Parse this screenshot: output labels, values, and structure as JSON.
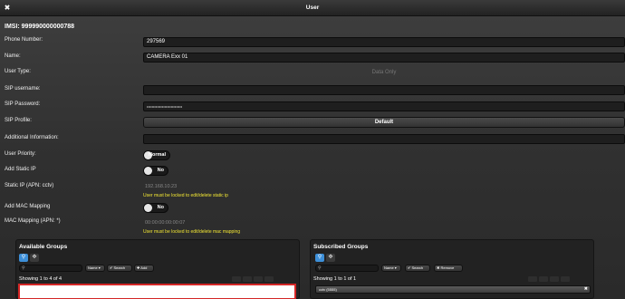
{
  "window": {
    "title": "User",
    "close_icon": "close-icon"
  },
  "imsi": "IMSI: 999990000000788",
  "fields": {
    "phone": {
      "label": "Phone Number:",
      "value": "297569"
    },
    "name": {
      "label": "Name:",
      "value": "CAMERA Exx 01"
    },
    "user_type": {
      "label": "User Type:",
      "value": "Data Only"
    },
    "sip_username": {
      "label": "SIP username:",
      "value": ""
    },
    "sip_password": {
      "label": "SIP Password:",
      "value": "••••••••••••••••••••••••••••"
    },
    "sip_profile": {
      "label": "SIP Profile:",
      "value": "Default"
    },
    "additional_info": {
      "label": "Additional Information:",
      "value": ""
    },
    "user_priority": {
      "label": "User Priority:",
      "value": "Normal"
    },
    "add_static_ip": {
      "label": "Add Static IP",
      "value": "No"
    },
    "static_ip": {
      "label": "Static IP (APN: cctv)",
      "value": "192.168.10.23",
      "warning": "User must be locked to edit/delete static ip"
    },
    "add_mac": {
      "label": "Add MAC Mapping",
      "value": "No"
    },
    "mac_mapping": {
      "label": "MAC Mapping (APN: *)",
      "value": "00:00:00:00:00:07",
      "warning": "User must be locked to edit/delete mac mapping"
    }
  },
  "available_groups": {
    "title": "Available Groups",
    "search_placeholder": "",
    "sort_select": "Name",
    "search_button": "Search",
    "add_button": "Add",
    "showing": "Showing 1 to 4 of 4"
  },
  "subscribed_groups": {
    "title": "Subscribed Groups",
    "search_placeholder": "",
    "sort_select": "Name",
    "search_button": "Search",
    "remove_button": "Remove",
    "showing": "Showing 1 to 1 of 1",
    "items": [
      "cctv (5555)"
    ]
  },
  "colors": {
    "accent": "#3d8fd8",
    "warning": "#f2e633",
    "highlight_border": "#d42626"
  }
}
